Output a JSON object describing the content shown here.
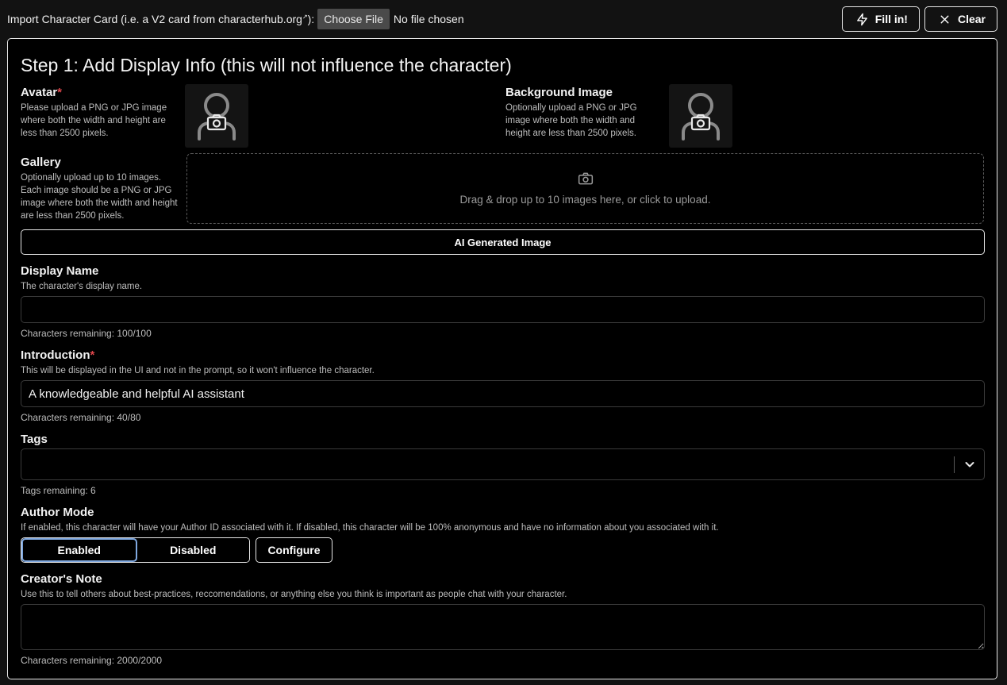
{
  "import": {
    "label": "Import Character Card (i.e. a V2 card from characterhub.org",
    "label_sup": "↗",
    "label_end": "):",
    "choose_file": "Choose File",
    "no_file": "No file chosen"
  },
  "actions": {
    "fill_in": "Fill in!",
    "clear": "Clear"
  },
  "step": {
    "title": "Step 1: Add Display Info (this will not influence the character)"
  },
  "avatar": {
    "label": "Avatar",
    "required": "*",
    "desc": "Please upload a PNG or JPG image where both the width and height are less than 2500 pixels."
  },
  "background": {
    "label": "Background Image",
    "desc": "Optionally upload a PNG or JPG image where both the width and height are less than 2500 pixels."
  },
  "gallery": {
    "label": "Gallery",
    "desc": "Optionally upload up to 10 images. Each image should be a PNG or JPG image where both the width and height are less than 2500 pixels.",
    "dropzone_text": "Drag & drop up to 10 images here, or click to upload."
  },
  "ai_generated": {
    "label": "AI Generated Image"
  },
  "display_name": {
    "label": "Display Name",
    "desc": "The character's display name.",
    "value": "",
    "counter": "Characters remaining: 100/100"
  },
  "introduction": {
    "label": "Introduction",
    "required": "*",
    "desc": "This will be displayed in the UI and not in the prompt, so it won't influence the character.",
    "value": "A knowledgeable and helpful AI assistant",
    "counter": "Characters remaining: 40/80"
  },
  "tags": {
    "label": "Tags",
    "counter": "Tags remaining: 6"
  },
  "author_mode": {
    "label": "Author Mode",
    "desc": "If enabled, this character will have your Author ID associated with it. If disabled, this character will be 100% anonymous and have no information about you associated with it.",
    "enabled": "Enabled",
    "disabled": "Disabled",
    "selected": "Enabled",
    "configure": "Configure"
  },
  "creators_note": {
    "label": "Creator's Note",
    "desc": "Use this to tell others about best-practices, reccomendations, or anything else you think is important as people chat with your character.",
    "value": "",
    "counter": "Characters remaining: 2000/2000"
  },
  "colors": {
    "background": "#121212",
    "panel": "#000000",
    "border": "#e6e6e6",
    "required": "#e0474c",
    "active_outline": "#7fa8e0"
  }
}
